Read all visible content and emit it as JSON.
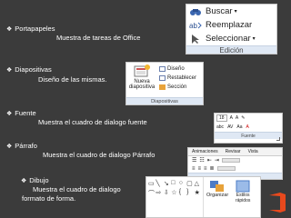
{
  "bullets": {
    "portapapeles": {
      "title": "Portapapeles",
      "desc": "Muestra de tareas de Office"
    },
    "diapositivas": {
      "title": "Diapositivas",
      "desc": "Diseño de las mismas."
    },
    "fuente": {
      "title": "Fuente",
      "desc": "Muestra el cuadro de dialogo fuente"
    },
    "parrafo": {
      "title": "Párrafo",
      "desc": "Muestra el cuadro de dialogo  Párrafo"
    },
    "dibujo": {
      "title": "Dibujo",
      "desc_line1": "Muestra el cuadro de dialogo",
      "desc_line2": "formato de forma."
    }
  },
  "edit_group": {
    "items": [
      "Buscar",
      "Reemplazar",
      "Seleccionar"
    ],
    "group_label": "Edición"
  },
  "slides_group": {
    "new_slide_label_1": "Nueva",
    "new_slide_label_2": "diapositiva",
    "items": [
      "Diseño",
      "Restablecer",
      "Sección"
    ],
    "group_label": "Diapositivas"
  },
  "font_group": {
    "size": "18",
    "group_label": "Fuente"
  },
  "para_group": {
    "tabs": [
      "Animaciones",
      "Revisar",
      "Vista"
    ]
  },
  "drawing_group": {
    "arrange_label": "Organizar",
    "quick_styles_label": "Estilos rápidos"
  },
  "colors": {
    "background": "#3b3b3b",
    "accent_orange": "#e8491d"
  }
}
